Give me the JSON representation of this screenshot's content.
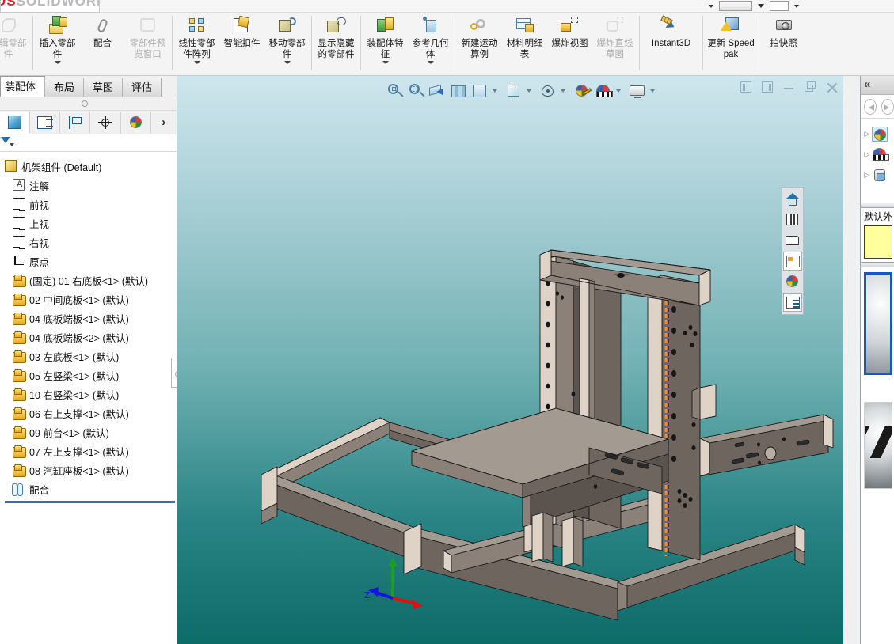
{
  "app": {
    "logo_text": "SOLIDWORKS",
    "logo_prefix": "DS"
  },
  "ribbon": {
    "commands": [
      {
        "label": "编辑零部件",
        "icon": "edit-component-icon",
        "disabled": true,
        "dropdown": false
      },
      {
        "label": "插入零部件",
        "icon": "insert-component-icon",
        "disabled": false,
        "dropdown": true
      },
      {
        "label": "配合",
        "icon": "mate-icon",
        "disabled": false,
        "dropdown": false
      },
      {
        "label": "零部件预览窗口",
        "icon": "component-preview-window-icon",
        "disabled": true,
        "dropdown": false
      },
      {
        "label": "线性零部件阵列",
        "icon": "linear-component-pattern-icon",
        "disabled": false,
        "dropdown": true
      },
      {
        "label": "智能扣件",
        "icon": "smart-fasteners-icon",
        "disabled": false,
        "dropdown": false
      },
      {
        "label": "移动零部件",
        "icon": "move-component-icon",
        "disabled": false,
        "dropdown": true
      },
      {
        "label": "显示隐藏的零部件",
        "icon": "show-hidden-components-icon",
        "disabled": false,
        "dropdown": false
      },
      {
        "label": "装配体特征",
        "icon": "assembly-features-icon",
        "disabled": false,
        "dropdown": true
      },
      {
        "label": "参考几何体",
        "icon": "reference-geometry-icon",
        "disabled": false,
        "dropdown": true
      },
      {
        "label": "新建运动算例",
        "icon": "new-motion-study-icon",
        "disabled": false,
        "dropdown": false
      },
      {
        "label": "材料明细表",
        "icon": "bill-of-materials-icon",
        "disabled": false,
        "dropdown": false
      },
      {
        "label": "爆炸视图",
        "icon": "exploded-view-icon",
        "disabled": false,
        "dropdown": false
      },
      {
        "label": "爆炸直线草图",
        "icon": "explode-line-sketch-icon",
        "disabled": true,
        "dropdown": false
      },
      {
        "label": "Instant3D",
        "icon": "instant3d-icon",
        "disabled": false,
        "dropdown": false
      },
      {
        "label": "更新 Speedpak",
        "icon": "update-speedpak-icon",
        "disabled": false,
        "dropdown": false
      },
      {
        "label": "拍快照",
        "icon": "take-snapshot-icon",
        "disabled": false,
        "dropdown": false
      }
    ]
  },
  "command_tabs": [
    {
      "label": "装配体",
      "active": true
    },
    {
      "label": "布局",
      "active": false
    },
    {
      "label": "草图",
      "active": false
    },
    {
      "label": "评估",
      "active": false
    }
  ],
  "feature_manager": {
    "tabs": [
      {
        "name": "feature-manager-tab",
        "icon": "blue-cube-icon",
        "selected": true
      },
      {
        "name": "property-manager-tab",
        "icon": "property-list-icon",
        "selected": false
      },
      {
        "name": "configuration-manager-tab",
        "icon": "configuration-flag-icon",
        "selected": false
      },
      {
        "name": "dimxpert-manager-tab",
        "icon": "dimxpert-crosshair-icon",
        "selected": false
      },
      {
        "name": "display-manager-tab",
        "icon": "appearance-ball-icon",
        "selected": false
      }
    ],
    "expand_arrow": "›",
    "filter_icon": "filter-icon",
    "tree": [
      {
        "label": "机架组件  (Default)",
        "icon": "assembly-icon",
        "indent": 0
      },
      {
        "label": "注解",
        "icon": "annotations-icon",
        "indent": 1
      },
      {
        "label": "前视",
        "icon": "plane-icon",
        "indent": 1
      },
      {
        "label": "上视",
        "icon": "plane-icon",
        "indent": 1
      },
      {
        "label": "右视",
        "icon": "plane-icon",
        "indent": 1
      },
      {
        "label": "原点",
        "icon": "origin-icon",
        "indent": 1
      },
      {
        "label": "(固定) 01 右底板<1>  (默认)",
        "icon": "part-icon",
        "indent": 1
      },
      {
        "label": "02 中间底板<1>  (默认)",
        "icon": "part-icon",
        "indent": 1
      },
      {
        "label": "04 底板端板<1>  (默认)",
        "icon": "part-icon",
        "indent": 1
      },
      {
        "label": "04 底板端板<2>  (默认)",
        "icon": "part-icon",
        "indent": 1
      },
      {
        "label": "03 左底板<1>  (默认)",
        "icon": "part-icon",
        "indent": 1
      },
      {
        "label": "05 左竖梁<1>  (默认)",
        "icon": "part-icon",
        "indent": 1
      },
      {
        "label": "10 右竖梁<1>  (默认)",
        "icon": "part-icon",
        "indent": 1
      },
      {
        "label": "06 右上支撑<1>  (默认)",
        "icon": "part-icon",
        "indent": 1
      },
      {
        "label": "09 前台<1>  (默认)",
        "icon": "part-icon",
        "indent": 1
      },
      {
        "label": "07 左上支撑<1>  (默认)",
        "icon": "part-icon",
        "indent": 1
      },
      {
        "label": "08 汽缸座板<1>  (默认)",
        "icon": "part-icon",
        "indent": 1
      },
      {
        "label": "配合",
        "icon": "mates-folder-icon",
        "indent": 1
      }
    ]
  },
  "view_toolbar": [
    {
      "name": "zoom-to-fit-button",
      "icon": "zoom-to-fit-icon",
      "dropdown": false
    },
    {
      "name": "zoom-to-area-button",
      "icon": "zoom-to-area-icon",
      "dropdown": false
    },
    {
      "name": "section-view-button",
      "icon": "section-view-icon",
      "dropdown": false
    },
    {
      "name": "view-orientation-button",
      "icon": "view-orientation-icon",
      "dropdown": false
    },
    {
      "name": "display-style-button",
      "icon": "display-style-icon",
      "dropdown": true
    },
    {
      "name": "hide-show-items-button",
      "icon": "hide-show-items-icon",
      "dropdown": true
    },
    {
      "name": "edit-appearance-button",
      "icon": "edit-appearance-icon",
      "dropdown": true
    },
    {
      "name": "apply-scene-button",
      "icon": "apply-scene-icon",
      "dropdown": true
    },
    {
      "name": "view-settings-button",
      "icon": "view-settings-icon",
      "dropdown": true
    }
  ],
  "window_controls": [
    {
      "name": "previous-window-button",
      "icon": "prev-window-icon"
    },
    {
      "name": "next-window-button",
      "icon": "next-window-icon"
    },
    {
      "name": "minimize-button",
      "icon": "minimize-icon"
    },
    {
      "name": "restore-button",
      "icon": "restore-icon"
    },
    {
      "name": "close-button",
      "icon": "close-icon"
    }
  ],
  "heads_up_strip": [
    {
      "name": "home-button",
      "icon": "home-icon",
      "selected": false
    },
    {
      "name": "design-library-button",
      "icon": "design-library-icon",
      "selected": false
    },
    {
      "name": "file-explorer-button",
      "icon": "file-explorer-icon",
      "selected": false
    },
    {
      "name": "view-palette-button",
      "icon": "view-palette-icon",
      "selected": true
    },
    {
      "name": "appearances-scenes-button",
      "icon": "appearances-ball-icon",
      "selected": false
    },
    {
      "name": "custom-properties-button",
      "icon": "custom-properties-icon",
      "selected": true
    }
  ],
  "task_pane": {
    "collapse_icon": "double-chevron-left-icon",
    "nav": [
      {
        "name": "task-pane-back-button",
        "icon": "back-arrow-icon"
      },
      {
        "name": "task-pane-forward-button",
        "icon": "forward-arrow-icon"
      }
    ],
    "tree": [
      {
        "name": "appearances-node",
        "icon": "appearance-ball-icon",
        "selected": true
      },
      {
        "name": "scenes-node",
        "icon": "scene-ball-icon",
        "selected": false
      },
      {
        "name": "decals-node",
        "icon": "decal-icon",
        "selected": false
      }
    ],
    "category_label": "默认外",
    "swatch_color": "#ffff9e",
    "selected_thumb_border": "#1658c8"
  },
  "graphics": {
    "background_top": "#cfe6ee",
    "background_bottom": "#0d6b68",
    "triad_axes": [
      {
        "label": "Z",
        "color": "#2020ee"
      },
      {
        "label": "",
        "color": "#ee2020"
      },
      {
        "label": "",
        "color": "#20c020"
      }
    ],
    "highlighted_edge_color": "#ff8c1a",
    "model_name": "机架组件"
  }
}
